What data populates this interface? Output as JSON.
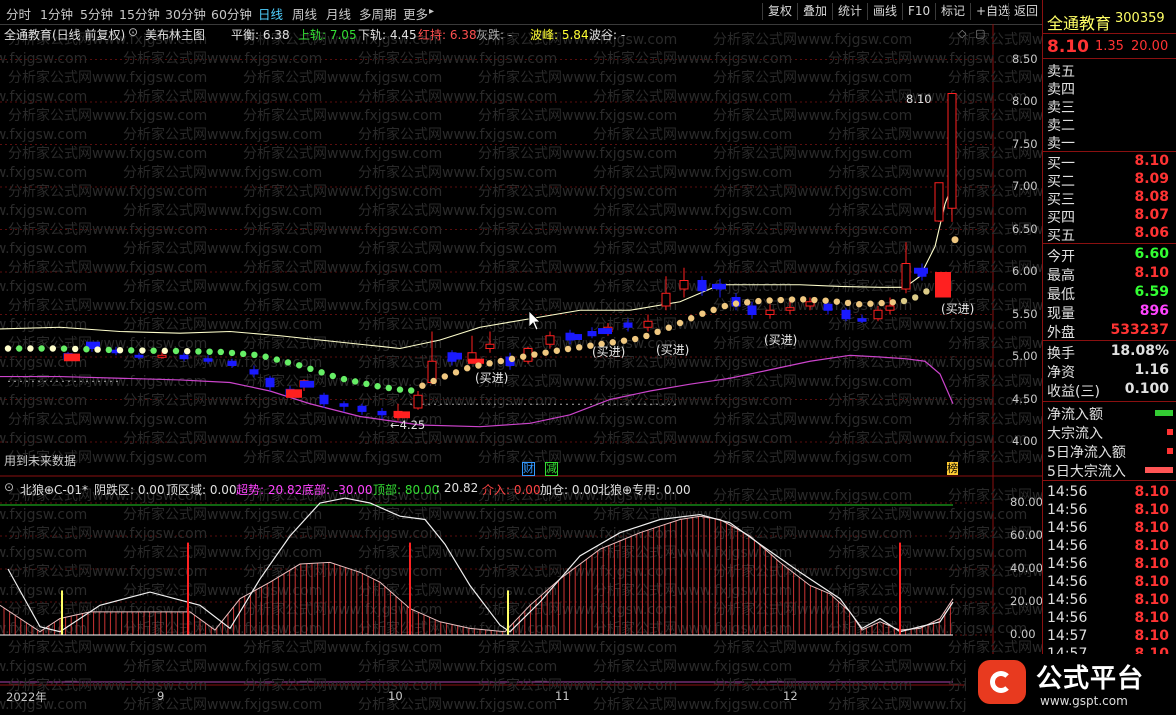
{
  "toolbar": {
    "periods": [
      "分时",
      "1分钟",
      "5分钟",
      "15分钟",
      "30分钟",
      "60分钟",
      "日线",
      "周线",
      "月线",
      "多周期",
      "更多"
    ],
    "active_period": "日线",
    "more_arrow": "▸",
    "buttons": [
      "复权",
      "叠加",
      "统计",
      "画线",
      "F10",
      "标记",
      "+自选",
      "返回"
    ]
  },
  "main_chart": {
    "title": "全通教育(日线 前复权)",
    "indicator_name": "美布林主图",
    "legend": [
      {
        "label": "平衡: 6.38",
        "color": "#e0e0e0"
      },
      {
        "label": "上轨: 7.05",
        "color": "#33dd33"
      },
      {
        "label": "下轨: 4.45",
        "color": "#e0e0e0"
      },
      {
        "label": "红持: 6.38",
        "color": "#ff5050"
      },
      {
        "label": "灰跌: -",
        "color": "#aaaaaa"
      },
      {
        "label": "波峰: 5.84",
        "color": "#ffff33"
      },
      {
        "label": "波谷: -",
        "color": "#e0e0e0"
      }
    ],
    "y_ticks": [
      "8.50",
      "8.00",
      "7.50",
      "7.00",
      "6.50",
      "6.00",
      "5.50",
      "5.00",
      "4.50",
      "4.00"
    ],
    "last_price_label": "8.10",
    "low_label": "←4.25",
    "future_note": "用到未来数据",
    "buy_labels": [
      "(买进)",
      "(买进)",
      "(买进)",
      "(买进)",
      "(买进)"
    ],
    "event_badges": [
      {
        "text": "财",
        "color": "#3399ff"
      },
      {
        "text": "减",
        "color": "#33dd33"
      },
      {
        "text": "榜",
        "color": "#ffcc33"
      }
    ],
    "colors": {
      "up": "#ff2020",
      "down": "#1a1aff",
      "upper_band": "#ffffcc",
      "lower_band": "#cc44cc",
      "grid": "#5a0e0e"
    }
  },
  "sub_chart": {
    "legend": [
      {
        "label": "北狼⊕C-01*",
        "color": "#e0e0e0"
      },
      {
        "label": "阴跌区: 0.00",
        "color": "#e0e0e0"
      },
      {
        "label": "顶区域: 0.00",
        "color": "#e0e0e0"
      },
      {
        "label": "超势: 20.82",
        "color": "#ff44ff"
      },
      {
        "label": "底部: -30.00",
        "color": "#ff44ff"
      },
      {
        "label": "顶部: 80.00",
        "color": "#33dd33"
      },
      {
        "label": ": 20.82",
        "color": "#e0e0e0"
      },
      {
        "label": "介入: 0.00",
        "color": "#ff4444"
      },
      {
        "label": "加仓: 0.00",
        "color": "#e0e0e0"
      },
      {
        "label": "北狼⊕专用: 0.00",
        "color": "#e0e0e0"
      }
    ],
    "y_ticks": [
      "80.00",
      "60.00",
      "40.00",
      "20.00",
      "0.00"
    ]
  },
  "x_axis": {
    "labels": [
      "2022年",
      "9",
      "10",
      "11",
      "12"
    ]
  },
  "watermark": "分析家公式网www.fxjgsw.com",
  "quote_panel": {
    "name": "全通教育",
    "code": "300359",
    "price": "8.10",
    "change": "1.35",
    "change_pct": "20.00",
    "asks": [
      "卖五",
      "卖四",
      "卖三",
      "卖二",
      "卖一"
    ],
    "bids": [
      {
        "label": "买一",
        "price": "8.10"
      },
      {
        "label": "买二",
        "price": "8.09"
      },
      {
        "label": "买三",
        "price": "8.08"
      },
      {
        "label": "买四",
        "price": "8.07"
      },
      {
        "label": "买五",
        "price": "8.06"
      }
    ],
    "stats1": [
      {
        "label": "今开",
        "value": "6.60",
        "color": "#33ff33"
      },
      {
        "label": "最高",
        "value": "8.10",
        "color": "#ff3333"
      },
      {
        "label": "最低",
        "value": "6.59",
        "color": "#33ff33"
      },
      {
        "label": "现量",
        "value": "896",
        "color": "#ff44ff"
      },
      {
        "label": "外盘",
        "value": "533237",
        "color": "#ff3333"
      }
    ],
    "stats2": [
      {
        "label": "换手",
        "value": "18.08%",
        "color": "#e0e0e0"
      },
      {
        "label": "净资",
        "value": "1.16",
        "color": "#e0e0e0"
      },
      {
        "label": "收益(三)",
        "value": "0.100",
        "color": "#e0e0e0"
      }
    ],
    "flows": [
      "净流入额",
      "大宗流入",
      "5日净流入额",
      "5日大宗流入"
    ],
    "ticks": [
      {
        "time": "14:56",
        "price": "8.10"
      },
      {
        "time": "14:56",
        "price": "8.10"
      },
      {
        "time": "14:56",
        "price": "8.10"
      },
      {
        "time": "14:56",
        "price": "8.10"
      },
      {
        "time": "14:56",
        "price": "8.10"
      },
      {
        "time": "14:56",
        "price": "8.10"
      },
      {
        "time": "14:56",
        "price": "8.10"
      },
      {
        "time": "14:56",
        "price": "8.10"
      },
      {
        "time": "14:57",
        "price": "8.10"
      },
      {
        "time": "14:57",
        "price": "8.10"
      }
    ]
  },
  "brand": {
    "text": "公式平台",
    "url": "www.gspt.com"
  }
}
